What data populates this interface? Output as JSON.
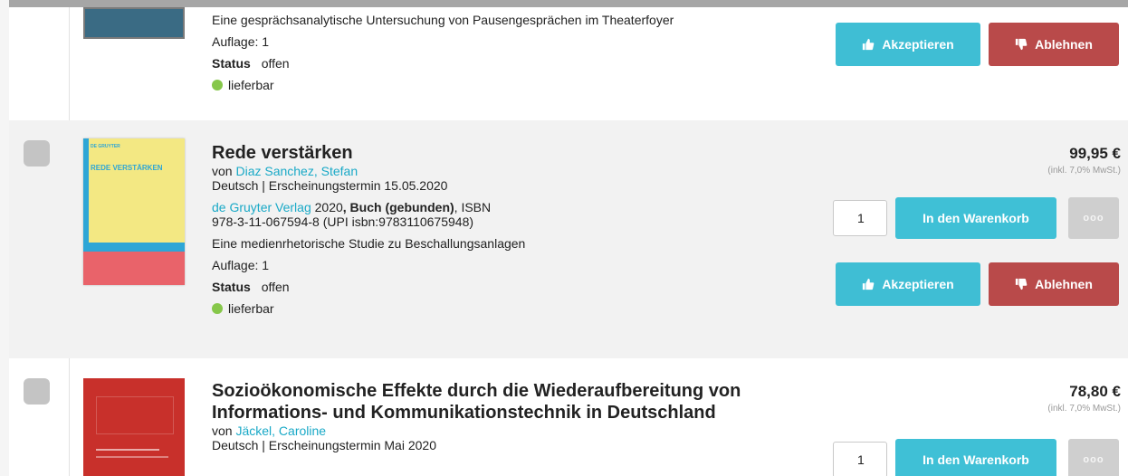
{
  "items": [
    {
      "subtitle": "Eine gesprächsanalytische Untersuchung von Pausengesprächen im Theaterfoyer",
      "edition": "Auflage: 1",
      "status_label": "Status",
      "status_value": "offen",
      "availability": "lieferbar",
      "accept_label": "Akzeptieren",
      "reject_label": "Ablehnen"
    },
    {
      "title": "Rede verstärken",
      "by": "von",
      "author": "Diaz Sanchez, Stefan",
      "lang_date": "Deutsch | Erscheinungstermin 15.05.2020",
      "publisher": "de Gruyter Verlag",
      "year": "2020",
      "binding": ", Buch (gebunden)",
      "isbn_prefix": ", ISBN",
      "isbn_line": "978-3-11-067594-8 (UPI isbn:9783110675948)",
      "subtitle": "Eine medienrhetorische Studie zu Beschallungsanlagen",
      "edition": "Auflage: 1",
      "status_label": "Status",
      "status_value": "offen",
      "availability": "lieferbar",
      "price": "99,95 €",
      "tax": "(inkl. 7,0% MwSt.)",
      "qty": "1",
      "cart_label": "In den Warenkorb",
      "more_label": "ooo",
      "accept_label": "Akzeptieren",
      "reject_label": "Ablehnen",
      "cover": {
        "label": "DE GRUYTER",
        "title": "REDE VERSTÄRKEN",
        "bg": "#f3e883",
        "spine": "#2ea6d6",
        "bottom": "#e9636a"
      }
    },
    {
      "title_line1": "Sozioökonomische Effekte durch die Wiederaufbereitung von",
      "title_line2": "Informations- und Kommunikationstechnik in Deutschland",
      "by": "von",
      "author": "Jäckel, Caroline",
      "lang_date": "Deutsch | Erscheinungstermin Mai 2020",
      "price": "78,80 €",
      "tax": "(inkl. 7,0% MwSt.)",
      "qty": "1",
      "cart_label": "In den Warenkorb",
      "more_label": "ooo",
      "cover": {
        "bg": "#c8302b"
      }
    }
  ],
  "colors": {
    "accent": "#3fc0d6",
    "reject": "#b94a4a",
    "link": "#19a9c7",
    "available": "#86c74a"
  }
}
